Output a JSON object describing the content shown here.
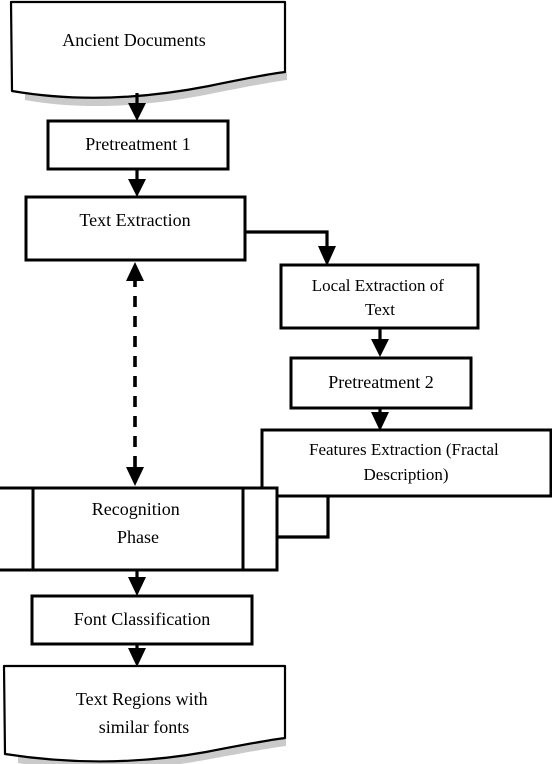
{
  "diagram": {
    "title": "Ancient document font recognition pipeline",
    "type": "flowchart",
    "background_color": "#ffffff",
    "line_color": "#000000",
    "shadow_color": "#9a9a9a",
    "nodes": [
      {
        "id": "ancient-documents",
        "label": "Ancient Documents",
        "shape": "document",
        "lines": [
          "Ancient Documents"
        ]
      },
      {
        "id": "pretreatment-1",
        "label": "Pretreatment 1",
        "shape": "process",
        "lines": [
          "Pretreatment 1"
        ]
      },
      {
        "id": "text-extraction",
        "label": "Text Extraction",
        "shape": "process",
        "lines": [
          "Text Extraction"
        ]
      },
      {
        "id": "local-extraction-of-text",
        "label": "Local Extraction of Text",
        "shape": "process",
        "lines": [
          "Local Extraction of",
          "Text"
        ]
      },
      {
        "id": "pretreatment-2",
        "label": "Pretreatment 2",
        "shape": "process",
        "lines": [
          "Pretreatment 2"
        ]
      },
      {
        "id": "features-extraction",
        "label": "Features Extraction (Fractal Description)",
        "shape": "process",
        "lines": [
          "Features Extraction (Fractal",
          "Description)"
        ]
      },
      {
        "id": "recognition-phase",
        "label": "Recognition Phase",
        "shape": "predefined-process",
        "lines": [
          "Recognition",
          "Phase"
        ]
      },
      {
        "id": "font-classification",
        "label": "Font Classification",
        "shape": "process",
        "lines": [
          "Font Classification"
        ]
      },
      {
        "id": "text-regions-similar-fonts",
        "label": "Text Regions with similar fonts",
        "shape": "document",
        "lines": [
          "Text Regions with",
          "similar fonts"
        ]
      }
    ],
    "edges": [
      {
        "id": "edge-documents-to-pretreatment1",
        "from": "ancient-documents",
        "to": "pretreatment-1",
        "style": "solid",
        "arrows": "end"
      },
      {
        "id": "edge-pretreatment1-to-textextraction",
        "from": "pretreatment-1",
        "to": "text-extraction",
        "style": "solid",
        "arrows": "end"
      },
      {
        "id": "edge-textextraction-to-localextraction",
        "from": "text-extraction",
        "to": "local-extraction-of-text",
        "style": "solid",
        "arrows": "end"
      },
      {
        "id": "edge-localextraction-to-pretreatment2",
        "from": "local-extraction-of-text",
        "to": "pretreatment-2",
        "style": "solid",
        "arrows": "end"
      },
      {
        "id": "edge-pretreatment2-to-featuresextraction",
        "from": "pretreatment-2",
        "to": "features-extraction",
        "style": "solid",
        "arrows": "end"
      },
      {
        "id": "edge-featuresextraction-to-recognitionphase",
        "from": "features-extraction",
        "to": "recognition-phase",
        "style": "solid",
        "arrows": "end"
      },
      {
        "id": "edge-textextraction-recognitionphase-bidirectional",
        "from": "text-extraction",
        "to": "recognition-phase",
        "style": "dashed",
        "arrows": "both"
      },
      {
        "id": "edge-recognitionphase-to-fontclassification",
        "from": "recognition-phase",
        "to": "font-classification",
        "style": "solid",
        "arrows": "end"
      },
      {
        "id": "edge-fontclassification-to-textregions",
        "from": "font-classification",
        "to": "text-regions-similar-fonts",
        "style": "solid",
        "arrows": "end"
      }
    ]
  }
}
